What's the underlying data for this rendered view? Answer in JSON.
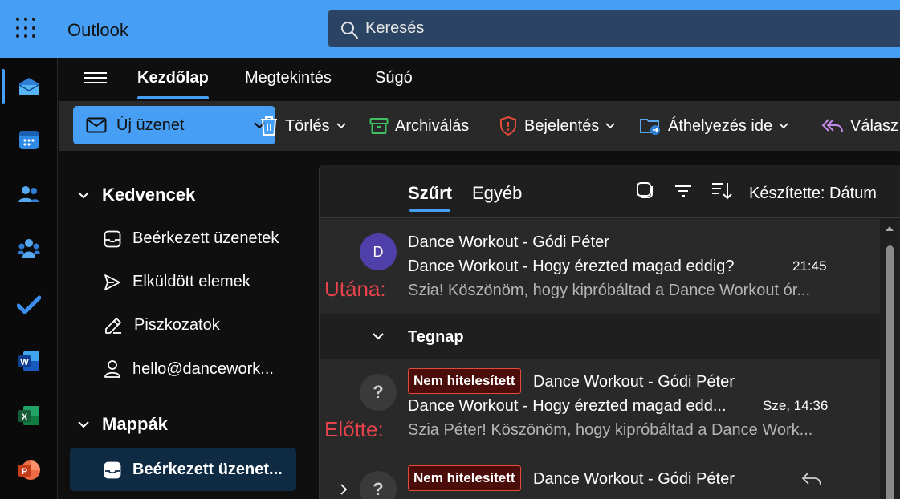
{
  "app": {
    "name": "Outlook"
  },
  "search": {
    "placeholder": "Keresés"
  },
  "ribbon": {
    "tabs": [
      {
        "label": "Kezdőlap",
        "active": true
      },
      {
        "label": "Megtekintés",
        "active": false
      },
      {
        "label": "Súgó",
        "active": false
      }
    ]
  },
  "toolbar": {
    "new_message": "Új üzenet",
    "delete": "Törlés",
    "archive": "Archiválás",
    "report": "Bejelentés",
    "move_to": "Áthelyezés ide",
    "reply": "Válasz"
  },
  "folders": {
    "favorites_header": "Kedvencek",
    "favorites": [
      {
        "label": "Beérkezett üzenetek",
        "icon": "inbox-icon"
      },
      {
        "label": "Elküldött elemek",
        "icon": "send-icon"
      },
      {
        "label": "Piszkozatok",
        "icon": "draft-icon"
      },
      {
        "label": "hello@dancework...",
        "icon": "person-icon"
      }
    ],
    "folders_header": "Mappák",
    "selected": {
      "label": "Beérkezett üzenet...",
      "icon": "inbox-icon"
    }
  },
  "message_list": {
    "tabs": [
      {
        "label": "Szűrt",
        "active": true
      },
      {
        "label": "Egyéb",
        "active": false
      }
    ],
    "sort_label": "Készítette: Dátum",
    "messages": [
      {
        "avatar": "D",
        "note": "Utána:",
        "sender": "Dance Workout - Gódi Péter",
        "subject": "Dance Workout - Hogy érezted magad eddig?",
        "time": "21:45",
        "preview": "Szia! Köszönöm, hogy kipróbáltad a Dance Workout ór..."
      },
      {
        "avatar": "?",
        "note": "Előtte:",
        "badge": "Nem hitelesített",
        "sender": "Dance Workout - Gódi Péter",
        "subject": "Dance Workout - Hogy érezted magad edd...",
        "time": "Sze, 14:36",
        "preview": "Szia Péter! Köszönöm, hogy kipróbáltad a Dance Work..."
      },
      {
        "avatar": "?",
        "badge": "Nem hitelesített",
        "sender": "Dance Workout - Gódi Péter"
      }
    ],
    "day_group": "Tegnap"
  },
  "colors": {
    "accent": "#479ef5",
    "annotation": "#e8434c",
    "badge_border": "#e24b3a"
  }
}
